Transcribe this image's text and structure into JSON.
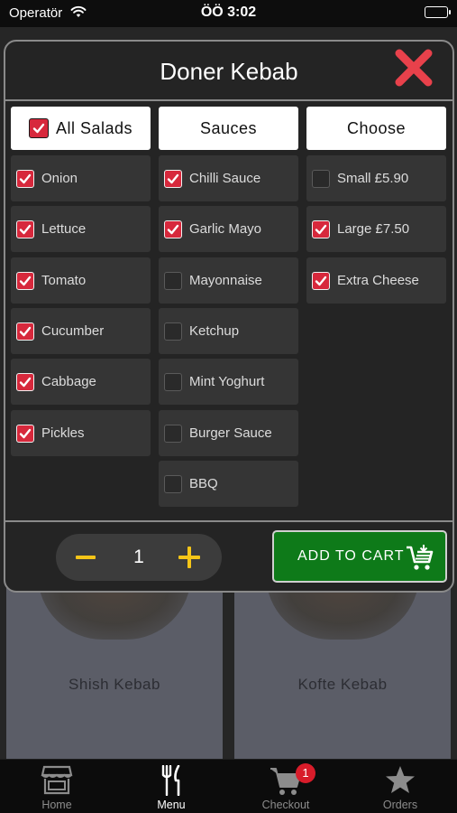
{
  "status_bar": {
    "carrier": "Operatör",
    "time": "ÖÖ 3:02"
  },
  "background_menu": {
    "items": [
      {
        "name": "Shish Kebab"
      },
      {
        "name": "Kofte Kebab"
      }
    ]
  },
  "modal": {
    "title": "Doner Kebab",
    "columns": [
      {
        "heading": "All Salads",
        "heading_checked": true,
        "items": [
          {
            "label": "Onion",
            "checked": true
          },
          {
            "label": "Lettuce",
            "checked": true
          },
          {
            "label": "Tomato",
            "checked": true
          },
          {
            "label": "Cucumber",
            "checked": true
          },
          {
            "label": "Cabbage",
            "checked": true
          },
          {
            "label": "Pickles",
            "checked": true
          }
        ]
      },
      {
        "heading": "Sauces",
        "items": [
          {
            "label": "Chilli Sauce",
            "checked": true
          },
          {
            "label": "Garlic Mayo",
            "checked": true
          },
          {
            "label": "Mayonnaise",
            "checked": false
          },
          {
            "label": "Ketchup",
            "checked": false
          },
          {
            "label": "Mint Yoghurt",
            "checked": false
          },
          {
            "label": "Burger Sauce",
            "checked": false
          },
          {
            "label": "BBQ",
            "checked": false
          }
        ]
      },
      {
        "heading": "Choose",
        "items": [
          {
            "label": "Small £5.90",
            "checked": false
          },
          {
            "label": "Large £7.50",
            "checked": true
          },
          {
            "label": "Extra Cheese",
            "checked": true
          }
        ]
      }
    ],
    "quantity": "1",
    "add_to_cart_label": "ADD TO CART"
  },
  "tab_bar": {
    "tabs": [
      {
        "label": "Home",
        "icon": "store-icon",
        "active": false
      },
      {
        "label": "Menu",
        "icon": "fork-knife-icon",
        "active": true
      },
      {
        "label": "Checkout",
        "icon": "cart-icon",
        "active": false,
        "badge": "1"
      },
      {
        "label": "Orders",
        "icon": "star-icon",
        "active": false
      }
    ]
  },
  "colors": {
    "accent_red": "#d7283c",
    "quantity_yellow": "#f5c518",
    "cart_green": "#0e7a19",
    "badge_red": "#d81c2a"
  }
}
